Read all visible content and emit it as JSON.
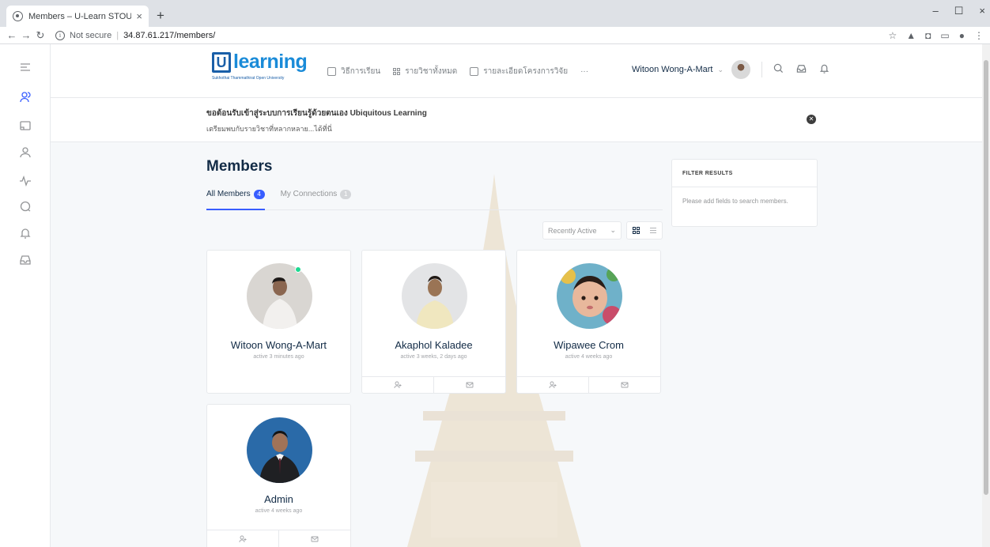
{
  "browser": {
    "tab_title": "Members – U-Learn STOU",
    "tab_close": "×",
    "new_tab": "+",
    "security": "Not secure",
    "url": "34.87.61.217/members/",
    "window_controls": [
      "–",
      "☐",
      "×"
    ]
  },
  "header": {
    "logo_letter": "U",
    "logo_word": "learning",
    "logo_sub": "Sukhothai Thammathirat Open University",
    "menu": [
      {
        "label": "วิธีการเรียน",
        "icon": "document-icon"
      },
      {
        "label": "รายวิชาทั้งหมด",
        "icon": "grid-icon"
      },
      {
        "label": "รายละเอียดโครงการวิจัย",
        "icon": "list-icon"
      }
    ],
    "more": "···",
    "user_name": "Witoon Wong-A-Mart"
  },
  "notice": {
    "line1": "ขอต้อนรับเข้าสู่ระบบการเรียนรู้ด้วยตนเอง Ubiquitous Learning",
    "line2": "เตรียมพบกับรายวิชาที่หลากหลาย...ได้ที่นี่",
    "close": "✕"
  },
  "page": {
    "title": "Members",
    "tabs": [
      {
        "label": "All Members",
        "count": "4"
      },
      {
        "label": "My Connections",
        "count": "1"
      }
    ],
    "sort": "Recently Active"
  },
  "members": [
    {
      "name": "Witoon Wong-A-Mart",
      "active": "active 3 minutes ago"
    },
    {
      "name": "Akaphol Kaladee",
      "active": "active 3 weeks, 2 days ago"
    },
    {
      "name": "Wipawee Crom",
      "active": "active 4 weeks ago"
    },
    {
      "name": "Admin",
      "active": "active 4 weeks ago"
    }
  ],
  "filter": {
    "title": "FILTER RESULTS",
    "body": "Please add fields to search members."
  },
  "colors": {
    "accent": "#385dff",
    "online": "#1cd991",
    "text": "#122b46"
  }
}
